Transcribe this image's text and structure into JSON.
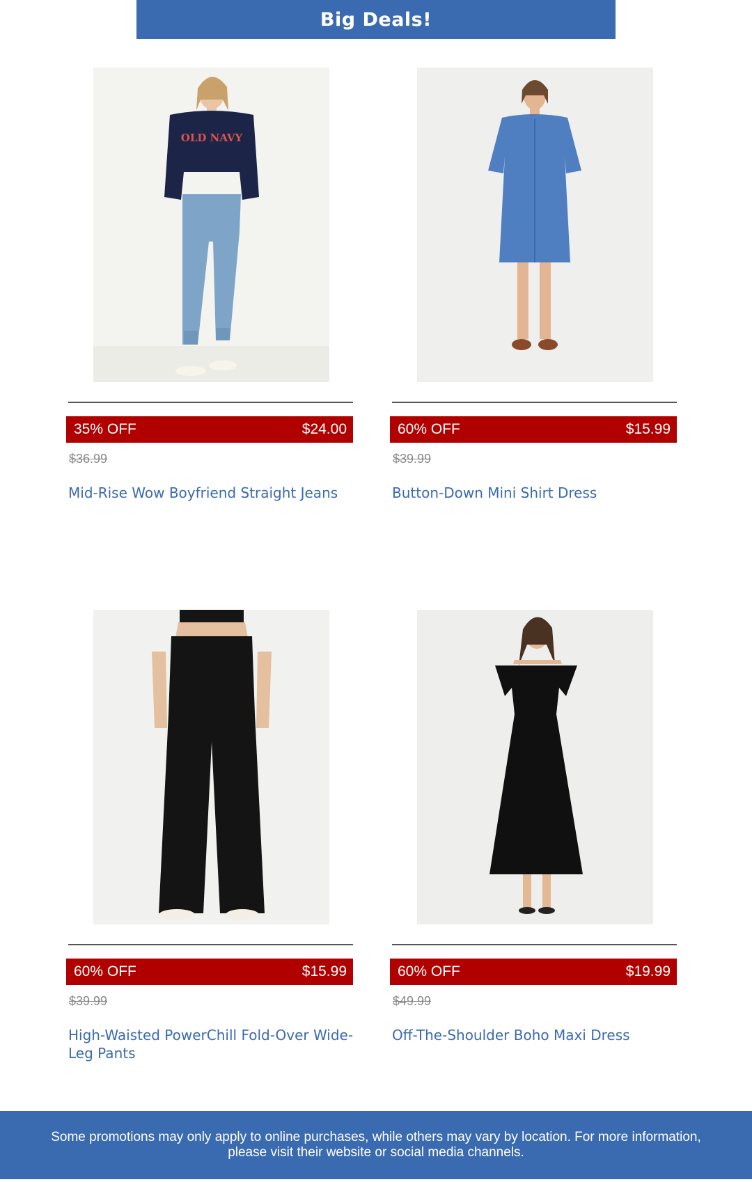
{
  "banner": {
    "title": "Big Deals!"
  },
  "colors": {
    "brand_blue": "#3a6ab0",
    "deal_red": "#b10000",
    "muted_gray": "#888888"
  },
  "products": [
    {
      "image_icon": "model-sweatshirt-jeans-image",
      "discount": "35% OFF",
      "price": "$24.00",
      "original_price": "$36.99",
      "name": "Mid-Rise Wow Boyfriend Straight Jeans"
    },
    {
      "image_icon": "model-denim-shirt-dress-image",
      "discount": "60% OFF",
      "price": "$15.99",
      "original_price": "$39.99",
      "name": "Button-Down Mini Shirt Dress"
    },
    {
      "image_icon": "model-black-wide-leg-pants-image",
      "discount": "60% OFF",
      "price": "$15.99",
      "original_price": "$39.99",
      "name": "High-Waisted PowerChill Fold-Over Wide-Leg Pants"
    },
    {
      "image_icon": "model-black-maxi-dress-image",
      "discount": "60% OFF",
      "price": "$19.99",
      "original_price": "$49.99",
      "name": "Off-The-Shoulder Boho Maxi Dress"
    }
  ],
  "footer": {
    "notice": "Some promotions may only apply to online purchases, while others may vary by location. For more information, please visit their website or social media channels."
  }
}
